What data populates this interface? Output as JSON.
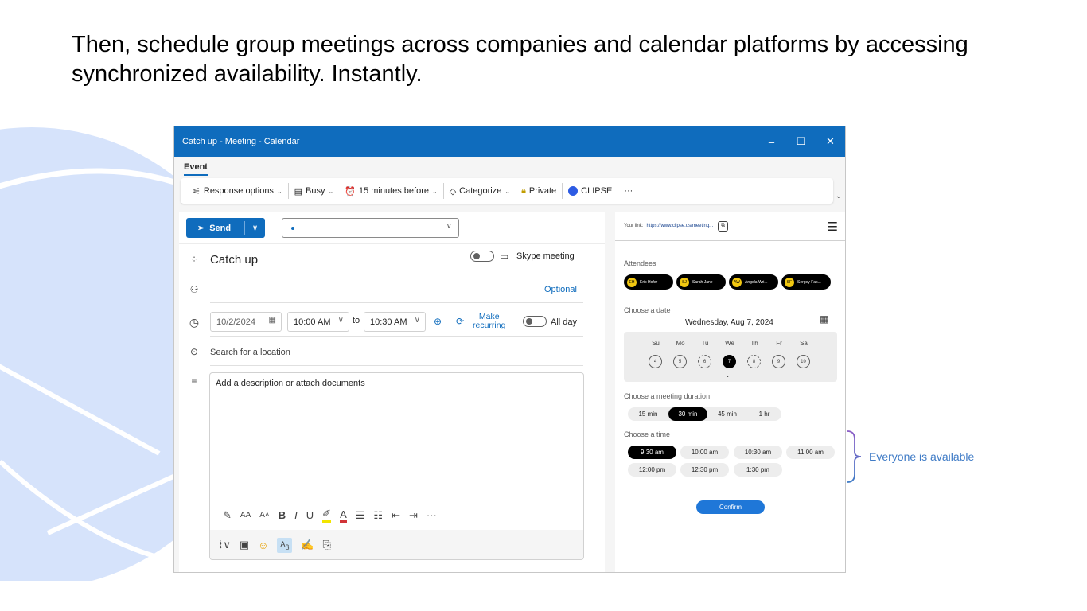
{
  "headline": "Then, schedule group meetings across companies and calendar platforms by accessing synchronized availability. Instantly.",
  "window": {
    "title": "Catch up - Meeting - Calendar",
    "controls": [
      "–",
      "☐",
      "✕"
    ]
  },
  "tabs": [
    {
      "label": "Event"
    }
  ],
  "ribbon": {
    "response_options": "Response options",
    "busy": "Busy",
    "reminder": "15 minutes before",
    "categorize": "Categorize",
    "private": "Private",
    "clipse": "CLIPSE",
    "more": "···"
  },
  "compose": {
    "send_label": "Send",
    "title": "Catch up",
    "skype_label": "Skype meeting",
    "optional_label": "Optional",
    "date": "10/2/2024",
    "start_time": "10:00 AM",
    "to_label": "to",
    "end_time": "10:30 AM",
    "make_recurring_line1": "Make",
    "make_recurring_line2": "recurring",
    "all_day_label": "All day",
    "location_placeholder": "Search for a location",
    "description_placeholder": "Add a description or attach documents"
  },
  "scheduler": {
    "link_label": "Your link:",
    "link_url": "https://www.clipse.us/meeting...",
    "attendees_label": "Attendees",
    "attendees": [
      {
        "initials": "EH",
        "name": "Eric Hofer"
      },
      {
        "initials": "SJ",
        "name": "Sarah Jane"
      },
      {
        "initials": "AW",
        "name": "Angela Wri..."
      },
      {
        "initials": "SF",
        "name": "Sergey Fas..."
      }
    ],
    "choose_date_label": "Choose a date",
    "selected_date": "Wednesday, Aug 7, 2024",
    "weekdays": [
      "Su",
      "Mo",
      "Tu",
      "We",
      "Th",
      "Fr",
      "Sa"
    ],
    "days": [
      "4",
      "5",
      "6",
      "7",
      "8",
      "9",
      "10"
    ],
    "selected_day": "7",
    "duration_label": "Choose a meeting duration",
    "durations": [
      "15 min",
      "30 min",
      "45 min",
      "1 hr"
    ],
    "selected_duration": "30 min",
    "time_label": "Choose a time",
    "times": [
      "9:30 am",
      "10:00 am",
      "10:30 am",
      "11:00 am",
      "12:00 pm",
      "12:30 pm",
      "1:30 pm"
    ],
    "selected_time": "9:30 am",
    "confirm_label": "Confirm"
  },
  "annotation": {
    "text": "Everyone is available",
    "color": "#3f7bc6"
  },
  "colors": {
    "accent": "#0f6cbd",
    "confirm": "#1f77d8",
    "deco": "#d6e3fb"
  }
}
